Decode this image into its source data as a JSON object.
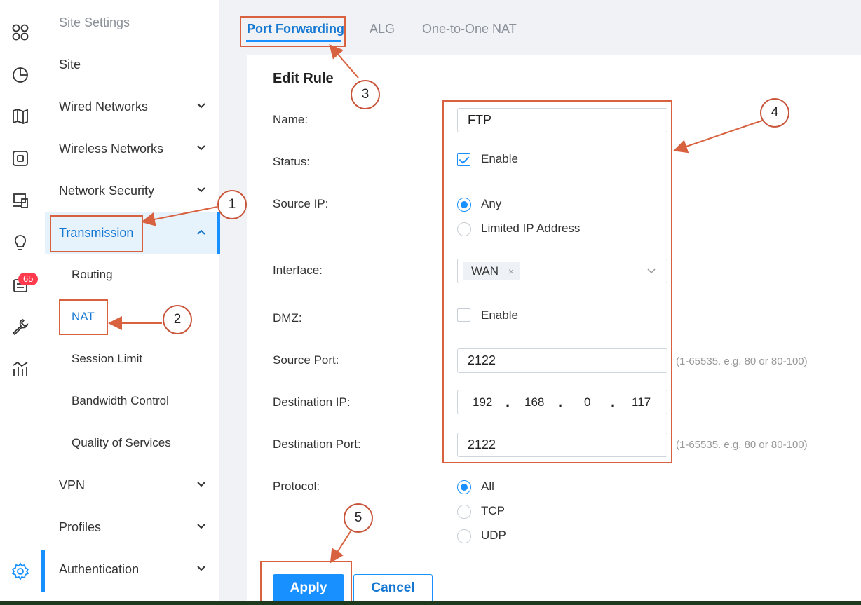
{
  "rail": {
    "icons": [
      "dashboard-icon",
      "statistics-icon",
      "map-icon",
      "devices-icon",
      "clients-icon",
      "insight-icon",
      "logs-icon",
      "tools-icon",
      "reports-icon",
      "settings-icon"
    ],
    "badge_count": "65"
  },
  "sidebar": {
    "title": "Site Settings",
    "items": [
      {
        "label": "Site"
      },
      {
        "label": "Wired Networks"
      },
      {
        "label": "Wireless Networks"
      },
      {
        "label": "Network Security"
      },
      {
        "label": "Transmission"
      },
      {
        "label": "Routing"
      },
      {
        "label": "NAT"
      },
      {
        "label": "Session Limit"
      },
      {
        "label": "Bandwidth Control"
      },
      {
        "label": "Quality of Services"
      },
      {
        "label": "VPN"
      },
      {
        "label": "Profiles"
      },
      {
        "label": "Authentication"
      }
    ]
  },
  "tabs": [
    {
      "label": "Port Forwarding",
      "active": true
    },
    {
      "label": "ALG",
      "active": false
    },
    {
      "label": "One-to-One NAT",
      "active": false
    }
  ],
  "form": {
    "title": "Edit Rule",
    "name": {
      "label": "Name:",
      "value": "FTP"
    },
    "status": {
      "label": "Status:",
      "option": "Enable",
      "checked": true
    },
    "source_ip": {
      "label": "Source IP:",
      "options": [
        "Any",
        "Limited IP Address"
      ],
      "selected": "Any"
    },
    "interface": {
      "label": "Interface:",
      "tag": "WAN",
      "tag_remove": "×"
    },
    "dmz": {
      "label": "DMZ:",
      "option": "Enable",
      "checked": false
    },
    "source_port": {
      "label": "Source Port:",
      "value": "2122",
      "hint": "(1-65535. e.g. 80 or 80-100)"
    },
    "destination_ip": {
      "label": "Destination IP:",
      "octets": [
        "192",
        "168",
        "0",
        "117"
      ],
      "separator": "."
    },
    "destination_port": {
      "label": "Destination Port:",
      "value": "2122",
      "hint": "(1-65535. e.g. 80 or 80-100)"
    },
    "protocol": {
      "label": "Protocol:",
      "options": [
        "All",
        "TCP",
        "UDP"
      ],
      "selected": "All"
    },
    "apply_label": "Apply",
    "cancel_label": "Cancel"
  },
  "annotations": {
    "color": "#d8623f",
    "callouts": [
      "1",
      "2",
      "3",
      "4",
      "5"
    ]
  },
  "colors": {
    "accent": "#1890ff",
    "badge": "#ff3b4d",
    "annotation": "#d8623f"
  }
}
